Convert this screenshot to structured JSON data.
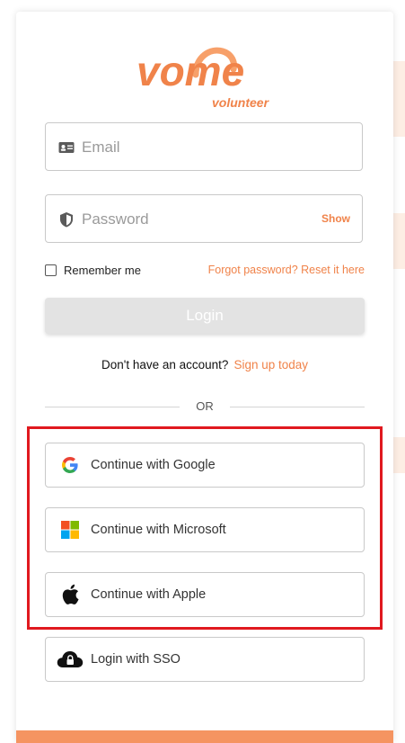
{
  "brand": {
    "name": "vome",
    "subtitle": "volunteer",
    "accent_color": "#f0834a"
  },
  "form": {
    "email_placeholder": "Email",
    "password_placeholder": "Password",
    "show_label": "Show",
    "remember_label": "Remember me",
    "forgot_label": "Forgot password? Reset it here",
    "login_label": "Login"
  },
  "signup": {
    "question": "Don't have an account?",
    "link": "Sign up today"
  },
  "divider": {
    "label": "OR"
  },
  "providers": [
    {
      "label": "Continue with Google",
      "icon": "google-icon"
    },
    {
      "label": "Continue with Microsoft",
      "icon": "microsoft-icon"
    },
    {
      "label": "Continue with Apple",
      "icon": "apple-icon"
    },
    {
      "label": "Login with SSO",
      "icon": "cloud-lock-icon"
    }
  ],
  "highlight_color": "#e0191f"
}
